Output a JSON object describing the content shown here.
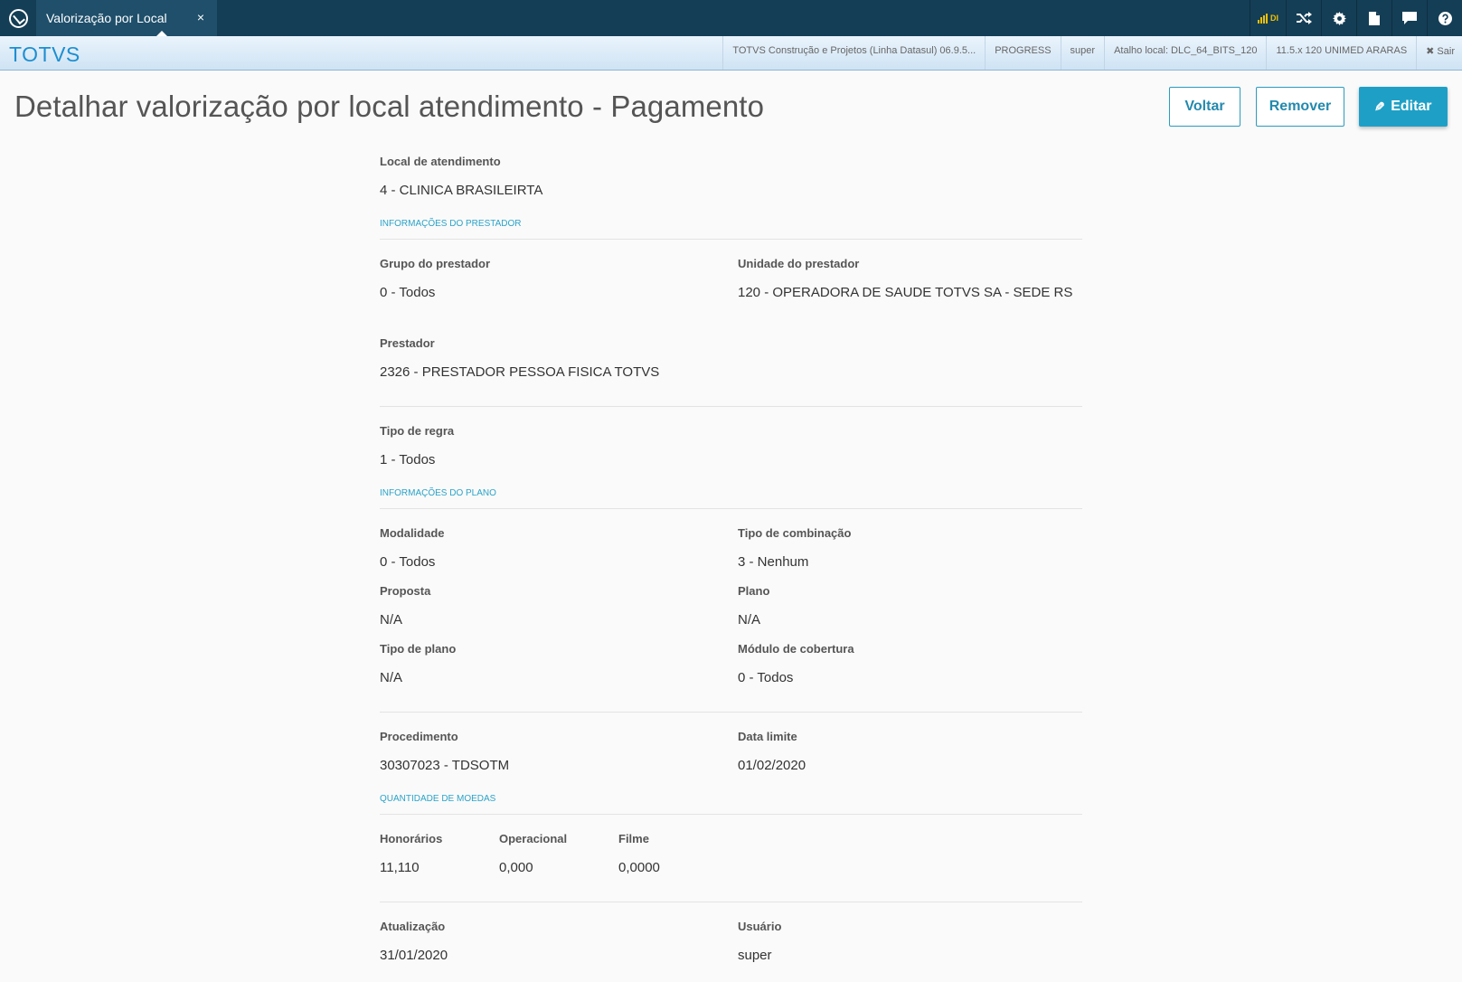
{
  "topbar": {
    "tab_label": "Valorização por Local",
    "tab_close": "×",
    "signal_label": "DI",
    "icons": [
      "shuffle-icon",
      "gear-icon",
      "document-icon",
      "chat-icon",
      "help-icon"
    ]
  },
  "subbar": {
    "brand": "TOTVS",
    "product": "TOTVS Construção e Projetos (Linha Datasul) 06.9.5...",
    "db": "PROGRESS",
    "user": "super",
    "shortcut": "Atalho local: DLC_64_BITS_120",
    "env": "11.5.x 120 UNIMED ARARAS",
    "logout": "✖ Sair"
  },
  "page": {
    "title": "Detalhar valorização por local atendimento - Pagamento",
    "btn_voltar": "Voltar",
    "btn_remover": "Remover",
    "btn_editar": "Editar"
  },
  "fields": {
    "local_label": "Local de atendimento",
    "local_value": "4 - CLINICA BRASILEIRTA",
    "sec_prestador": "Informações do prestador",
    "grupo_label": "Grupo do prestador",
    "grupo_value": "0 - Todos",
    "unidade_label": "Unidade do prestador",
    "unidade_value": "120 - OPERADORA DE SAUDE TOTVS SA - SEDE RS",
    "prestador_label": "Prestador",
    "prestador_value": "2326 - PRESTADOR PESSOA FISICA TOTVS",
    "tipo_regra_label": "Tipo de regra",
    "tipo_regra_value": "1 - Todos",
    "sec_plano": "Informações do plano",
    "modalidade_label": "Modalidade",
    "modalidade_value": "0 - Todos",
    "tipo_comb_label": "Tipo de combinação",
    "tipo_comb_value": "3 - Nenhum",
    "proposta_label": "Proposta",
    "proposta_value": "N/A",
    "plano_label": "Plano",
    "plano_value": "N/A",
    "tipo_plano_label": "Tipo de plano",
    "tipo_plano_value": "N/A",
    "modulo_label": "Módulo de cobertura",
    "modulo_value": "0 - Todos",
    "procedimento_label": "Procedimento",
    "procedimento_value": "30307023 - TDSOTM",
    "data_limite_label": "Data limite",
    "data_limite_value": "01/02/2020",
    "sec_moedas": "Quantidade de moedas",
    "honorarios_label": "Honorários",
    "honorarios_value": "11,110",
    "operacional_label": "Operacional",
    "operacional_value": "0,000",
    "filme_label": "Filme",
    "filme_value": "0,0000",
    "atualizacao_label": "Atualização",
    "atualizacao_value": "31/01/2020",
    "usuario_label": "Usuário",
    "usuario_value": "super"
  }
}
